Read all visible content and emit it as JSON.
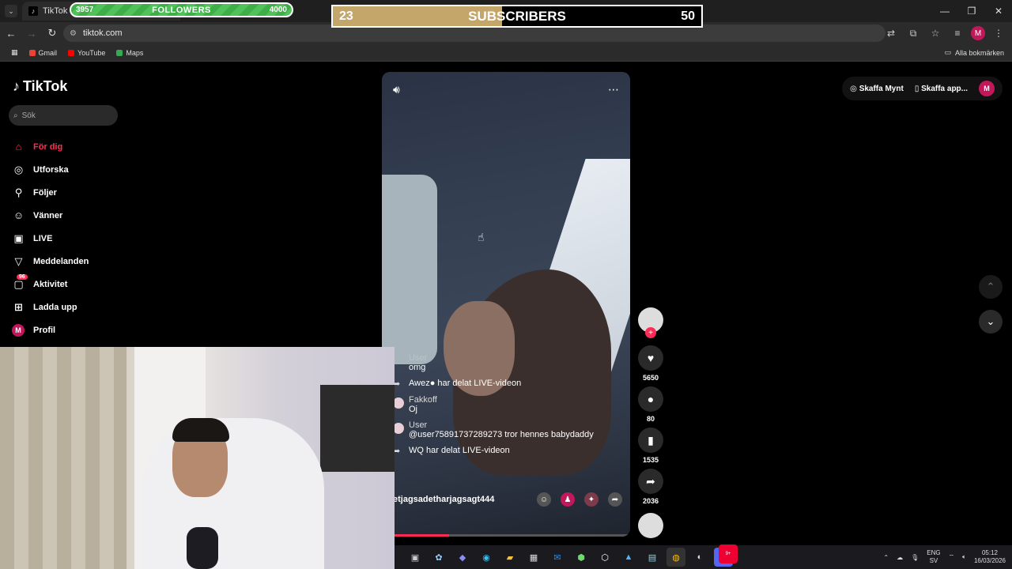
{
  "browser": {
    "tab_title": "TikTok - Ma",
    "url": "tiktok.com",
    "bookmarks": [
      {
        "label": "Gmail",
        "color": "#ea4335"
      },
      {
        "label": "YouTube",
        "color": "#ff0000"
      },
      {
        "label": "Maps",
        "color": "#34a853"
      }
    ],
    "all_bookmarks": "Alla bokmärken",
    "profile_initial": "M"
  },
  "overlays": {
    "followers": {
      "current": "3957",
      "label": "FOLLOWERS",
      "goal": "4000"
    },
    "subscribers": {
      "current": "23",
      "label": "SUBSCRIBERS",
      "goal": "50",
      "progress": 0.46
    }
  },
  "tiktok": {
    "brand": "TikTok",
    "search_placeholder": "Sök",
    "nav": [
      {
        "label": "För dig",
        "icon": "home-icon",
        "active": true
      },
      {
        "label": "Utforska",
        "icon": "compass-icon"
      },
      {
        "label": "Följer",
        "icon": "following-icon"
      },
      {
        "label": "Vänner",
        "icon": "friends-icon"
      },
      {
        "label": "LIVE",
        "icon": "live-icon"
      },
      {
        "label": "Meddelanden",
        "icon": "messages-icon"
      },
      {
        "label": "Aktivitet",
        "icon": "activity-icon",
        "badge": "96"
      },
      {
        "label": "Ladda upp",
        "icon": "upload-icon"
      },
      {
        "label": "Profil",
        "icon": "profile-avatar"
      }
    ],
    "topright": {
      "coins": "Skaffa Mynt",
      "app": "Skaffa app...",
      "avatar": "M"
    },
    "video": {
      "chat": [
        {
          "kind": "msg",
          "user": "User",
          "text": "omg"
        },
        {
          "kind": "share",
          "text": "Awez● har delat LIVE-videon"
        },
        {
          "kind": "msg",
          "user": "Fakkoff",
          "text": "Oj"
        },
        {
          "kind": "msg",
          "user": "User",
          "text": "@user75891737289273  tror hennes babydaddy"
        },
        {
          "kind": "share",
          "text": "WQ har delat LIVE-videon"
        }
      ],
      "host": "etjagsadetharjagsagt444",
      "progress": 0.27
    },
    "actions": {
      "likes": "5650",
      "comments": "80",
      "saves": "1535",
      "shares": "2036"
    }
  },
  "taskbar": {
    "lang": "ENG",
    "lang2": "SV",
    "time": "05:12",
    "date": "16/03/2026",
    "discord_badge": "9+"
  }
}
